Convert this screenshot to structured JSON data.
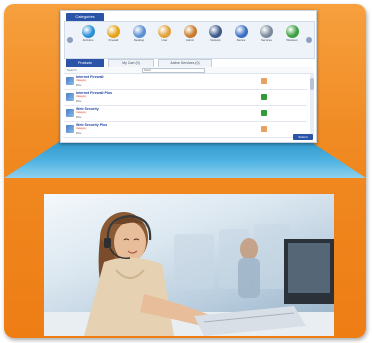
{
  "categories_panel": {
    "tab_label": "Categories",
    "items": [
      {
        "label": "Antivirus",
        "icon": "globe-icon",
        "color": "#2a8ed6"
      },
      {
        "label": "Firewall",
        "icon": "shield-icon",
        "color": "#e4a317"
      },
      {
        "label": "Desktop",
        "icon": "monitor-icon",
        "color": "#5a8fd0"
      },
      {
        "label": "User",
        "icon": "user-icon",
        "color": "#e0a13a"
      },
      {
        "label": "Admin",
        "icon": "admin-icon",
        "color": "#c87a2a"
      },
      {
        "label": "Network",
        "icon": "network-icon",
        "color": "#3d5a8a"
      },
      {
        "label": "Device",
        "icon": "device-icon",
        "color": "#3b6fc4"
      },
      {
        "label": "Services",
        "icon": "services-icon",
        "color": "#7a8a9a"
      },
      {
        "label": "Windows",
        "icon": "windows-icon",
        "color": "#3aa040"
      }
    ]
  },
  "product_tabs": [
    {
      "label": "Products",
      "active": true
    },
    {
      "label": "My Cart (0)",
      "active": false
    },
    {
      "label": "Active Services (0)",
      "active": false
    }
  ],
  "filter": {
    "label": "Search",
    "select_value": "Select"
  },
  "products": [
    {
      "name": "Internet Firewall",
      "subtitle": "Category",
      "meta": "Price",
      "action_color": "#e8a060"
    },
    {
      "name": "Internet Firewall Plus",
      "subtitle": "Category",
      "meta": "Price",
      "action_color": "#2e9a3a"
    },
    {
      "name": "Web Security",
      "subtitle": "Category",
      "meta": "Price",
      "action_color": "#2e9a3a"
    },
    {
      "name": "Web Security Plus",
      "subtitle": "Category",
      "meta": "Price",
      "action_color": "#e8a060"
    }
  ],
  "submit_label": "Submit"
}
